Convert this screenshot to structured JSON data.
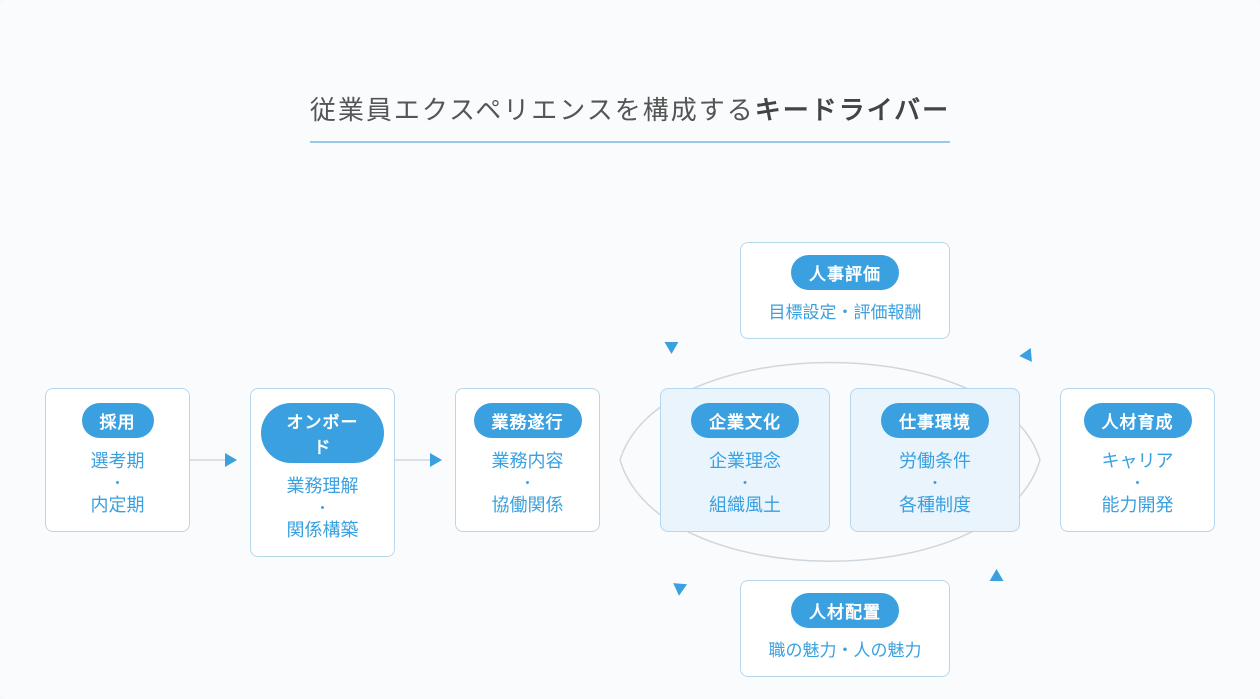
{
  "title": {
    "prefix": "従業員エクスペリエンスを構成する",
    "bold": "キードライバー"
  },
  "nodes": {
    "n1": {
      "pill": "採用",
      "line1": "選考期",
      "line2": "内定期"
    },
    "n2": {
      "pill": "オンボード",
      "line1": "業務理解",
      "line2": "関係構築"
    },
    "n3": {
      "pill": "業務遂行",
      "line1": "業務内容",
      "line2": "協働関係"
    },
    "n4": {
      "pill": "企業文化",
      "line1": "企業理念",
      "line2": "組織風土"
    },
    "n5": {
      "pill": "仕事環境",
      "line1": "労働条件",
      "line2": "各種制度"
    },
    "n6": {
      "pill": "人材育成",
      "line1": "キャリア",
      "line2": "能力開発"
    },
    "top": {
      "pill": "人事評価",
      "sub": "目標設定・評価報酬"
    },
    "bottom": {
      "pill": "人材配置",
      "sub": "職の魅力・人の魅力"
    }
  },
  "dot": "・"
}
